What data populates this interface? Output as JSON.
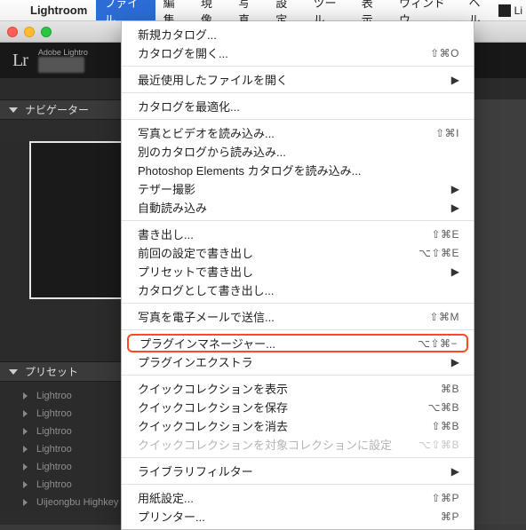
{
  "menubar": {
    "appname": "Lightroom",
    "items": [
      "ファイル",
      "編集",
      "現像",
      "写真",
      "設定",
      "ツール",
      "表示",
      "ウィンドウ",
      "ヘル"
    ],
    "tray_label": "Li"
  },
  "lrheader": {
    "logo": "Lr",
    "subtitle": "Adobe Lightro"
  },
  "panels": {
    "navigator_title": "ナビゲーター",
    "presets_title": "プリセット",
    "preset_items": [
      "Lightroo",
      "Lightroo",
      "Lightroo",
      "Lightroo",
      "Lightroo",
      "Lightroo",
      "Uijeongbu Highkey"
    ]
  },
  "menu": {
    "groups": [
      [
        {
          "label": "新規カタログ...",
          "shortcut": "",
          "submenu": false,
          "disabled": false,
          "hl": false
        },
        {
          "label": "カタログを開く...",
          "shortcut": "⇧⌘O",
          "submenu": false,
          "disabled": false,
          "hl": false
        }
      ],
      [
        {
          "label": "最近使用したファイルを開く",
          "shortcut": "",
          "submenu": true,
          "disabled": false,
          "hl": false
        }
      ],
      [
        {
          "label": "カタログを最適化...",
          "shortcut": "",
          "submenu": false,
          "disabled": false,
          "hl": false
        }
      ],
      [
        {
          "label": "写真とビデオを読み込み...",
          "shortcut": "⇧⌘I",
          "submenu": false,
          "disabled": false,
          "hl": false
        },
        {
          "label": "別のカタログから読み込み...",
          "shortcut": "",
          "submenu": false,
          "disabled": false,
          "hl": false
        },
        {
          "label": "Photoshop Elements カタログを読み込み...",
          "shortcut": "",
          "submenu": false,
          "disabled": false,
          "hl": false
        },
        {
          "label": "テザー撮影",
          "shortcut": "",
          "submenu": true,
          "disabled": false,
          "hl": false
        },
        {
          "label": "自動読み込み",
          "shortcut": "",
          "submenu": true,
          "disabled": false,
          "hl": false
        }
      ],
      [
        {
          "label": "書き出し...",
          "shortcut": "⇧⌘E",
          "submenu": false,
          "disabled": false,
          "hl": false
        },
        {
          "label": "前回の設定で書き出し",
          "shortcut": "⌥⇧⌘E",
          "submenu": false,
          "disabled": false,
          "hl": false
        },
        {
          "label": "プリセットで書き出し",
          "shortcut": "",
          "submenu": true,
          "disabled": false,
          "hl": false
        },
        {
          "label": "カタログとして書き出し...",
          "shortcut": "",
          "submenu": false,
          "disabled": false,
          "hl": false
        }
      ],
      [
        {
          "label": "写真を電子メールで送信...",
          "shortcut": "⇧⌘M",
          "submenu": false,
          "disabled": false,
          "hl": false
        }
      ],
      [
        {
          "label": "プラグインマネージャー...",
          "shortcut": "⌥⇧⌘−",
          "submenu": false,
          "disabled": false,
          "hl": true
        },
        {
          "label": "プラグインエクストラ",
          "shortcut": "",
          "submenu": true,
          "disabled": false,
          "hl": false
        }
      ],
      [
        {
          "label": "クイックコレクションを表示",
          "shortcut": "⌘B",
          "submenu": false,
          "disabled": false,
          "hl": false
        },
        {
          "label": "クイックコレクションを保存",
          "shortcut": "⌥⌘B",
          "submenu": false,
          "disabled": false,
          "hl": false
        },
        {
          "label": "クイックコレクションを消去",
          "shortcut": "⇧⌘B",
          "submenu": false,
          "disabled": false,
          "hl": false
        },
        {
          "label": "クイックコレクションを対象コレクションに設定",
          "shortcut": "⌥⇧⌘B",
          "submenu": false,
          "disabled": true,
          "hl": false
        }
      ],
      [
        {
          "label": "ライブラリフィルター",
          "shortcut": "",
          "submenu": true,
          "disabled": false,
          "hl": false
        }
      ],
      [
        {
          "label": "用紙設定...",
          "shortcut": "⇧⌘P",
          "submenu": false,
          "disabled": false,
          "hl": false
        },
        {
          "label": "プリンター...",
          "shortcut": "⌘P",
          "submenu": false,
          "disabled": false,
          "hl": false
        }
      ]
    ]
  }
}
